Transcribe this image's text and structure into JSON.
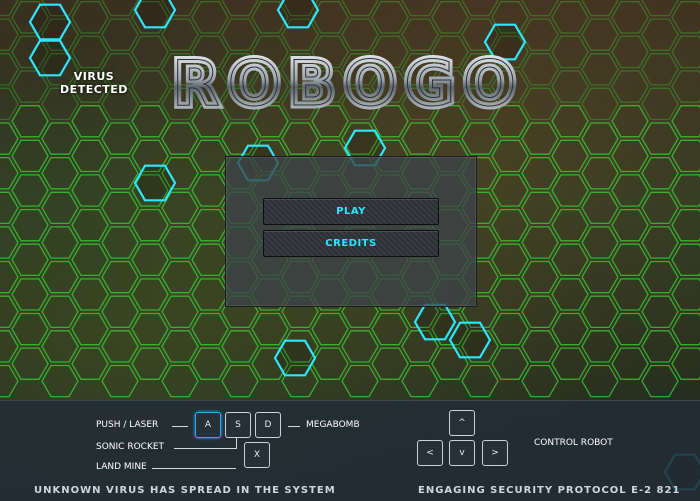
{
  "game": {
    "title": "ROBOGO",
    "virus_line1": "VIRUS",
    "virus_line2": "DETECTED"
  },
  "menu": {
    "play_label": "PLAY",
    "credits_label": "CREDITS"
  },
  "controls": {
    "push_laser_label": "PUSH / LASER",
    "megabomb_label": "MEGABOMB",
    "sonic_rocket_label": "SONIC ROCKET",
    "land_mine_label": "LAND MINE",
    "control_robot_label": "CONTROL  ROBOT",
    "keys": {
      "a": "A",
      "s": "S",
      "d": "D",
      "x": "X",
      "up": "^",
      "left": "<",
      "down": "v",
      "right": ">"
    }
  },
  "ticker": {
    "left": "UNKNOWN VIRUS HAS SPREAD IN THE SYSTEM",
    "right": "ENGAGING SECURITY PROTOCOL E-2 821"
  },
  "colors": {
    "accent_cyan": "#2ee6ff",
    "hex_green": "#3fd23a",
    "panel": "#3c4248",
    "bar": "#222c36"
  }
}
